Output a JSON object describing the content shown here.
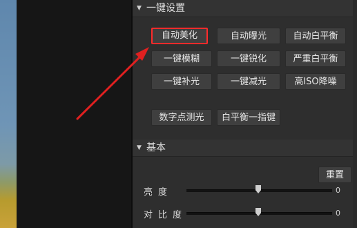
{
  "one_key_section": {
    "title": "一键设置",
    "buttons": [
      [
        "自动美化",
        "自动曝光",
        "自动白平衡"
      ],
      [
        "一键模糊",
        "一键锐化",
        "严重白平衡"
      ],
      [
        "一键补光",
        "一键减光",
        "高ISO降噪"
      ],
      [
        "数字点测光",
        "白平衡一指键"
      ]
    ],
    "highlighted": "自动美化"
  },
  "basic_section": {
    "title": "基本",
    "reset_label": "重置",
    "sliders": [
      {
        "label": "亮度",
        "value": "0"
      },
      {
        "label": "对比度",
        "value": "0"
      }
    ]
  },
  "colors": {
    "highlight_border": "#ff2b2b",
    "annotation_arrow": "#e02020"
  }
}
